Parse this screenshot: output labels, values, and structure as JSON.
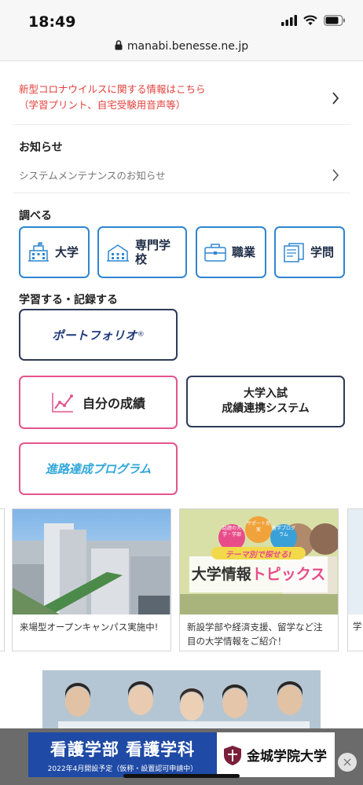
{
  "status": {
    "time": "18:49"
  },
  "browser": {
    "url": "manabi.benesse.ne.jp"
  },
  "notices": {
    "covid_line1": "新型コロナウイルスに関する情報はこちら",
    "covid_line2": "（学習プリント、自宅受験用音声等）",
    "oshirase_title": "お知らせ",
    "maintenance": "システムメンテナンスのお知らせ"
  },
  "search": {
    "title": "調べる",
    "items": [
      {
        "label": "大学",
        "icon": "university-icon"
      },
      {
        "label": "専門学校",
        "icon": "vocational-school-icon"
      },
      {
        "label": "職業",
        "icon": "briefcase-icon"
      },
      {
        "label": "学問",
        "icon": "documents-icon"
      }
    ]
  },
  "record": {
    "title": "学習する・記録する",
    "portfolio": "ポートフォリオ",
    "portfolio_mark": "®",
    "grades": "自分の成績",
    "exam_line1": "大学入試",
    "exam_line2": "成績連携システム",
    "career": "進路達成プログラム"
  },
  "cards": [
    {
      "caption": "来場型オープンキャンパス実施中!"
    },
    {
      "caption": "新設学部や経済支援、留学など注目の大学情報をご紹介！",
      "banner_sub": "テーマ別で探せる!",
      "banner_title_a": "大学情報",
      "banner_title_b": "トピックス",
      "bubbles": [
        "話題の大学・学部",
        "サポート充実",
        "留学プログラム"
      ]
    }
  ],
  "peek_right_caption": "学",
  "ad": {
    "line1": "看護学部 看護学科",
    "line2": "2022年4月開設予定（仮称・設置認可申請中）",
    "school": "金城学院大学",
    "close": "×"
  },
  "colors": {
    "accent_blue": "#2f86d1",
    "pink": "#e4558c",
    "navy": "#2e3a57",
    "red_notice": "#e0413b"
  }
}
